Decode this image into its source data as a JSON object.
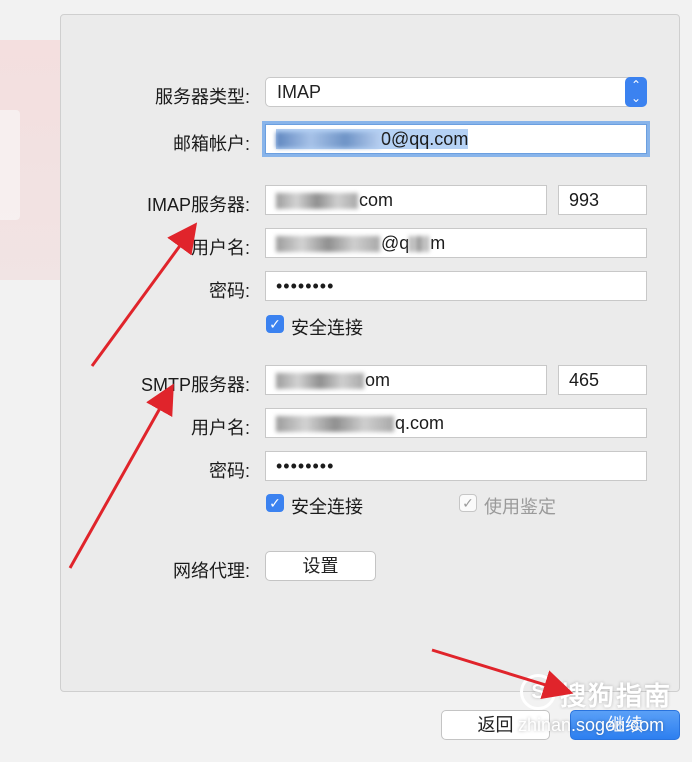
{
  "form": {
    "server_type_label": "服务器类型:",
    "server_type_value": "IMAP",
    "account_label": "邮箱帐户:",
    "account_suffix": "0@qq.com",
    "imap": {
      "server_label": "IMAP服务器:",
      "server_suffix": "com",
      "port": "993",
      "username_label": "用户名:",
      "username_suffix": "@q",
      "username_tail": "m",
      "password_label": "密码:",
      "password_value": "••••••••",
      "ssl_label": "安全连接",
      "ssl_checked": true
    },
    "smtp": {
      "server_label": "SMTP服务器:",
      "server_suffix": "om",
      "port": "465",
      "username_label": "用户名:",
      "username_suffix": "q.com",
      "password_label": "密码:",
      "password_value": "••••••••",
      "ssl_label": "安全连接",
      "ssl_checked": true,
      "auth_label": "使用鉴定",
      "auth_checked": true,
      "auth_disabled": true
    },
    "proxy_label": "网络代理:",
    "proxy_button": "设置"
  },
  "footer": {
    "back_button": "返回",
    "continue_button": "继续"
  },
  "watermark": {
    "brand": "搜狗指南",
    "url": "zhinan.sogou.com",
    "logo_letter": "S"
  },
  "colors": {
    "accent": "#3b82f0",
    "arrow": "#e0242b",
    "panel": "#ebebeb"
  },
  "icons": {
    "select_stepper": "chevron-updown-icon",
    "checkbox": "checkmark-icon"
  }
}
